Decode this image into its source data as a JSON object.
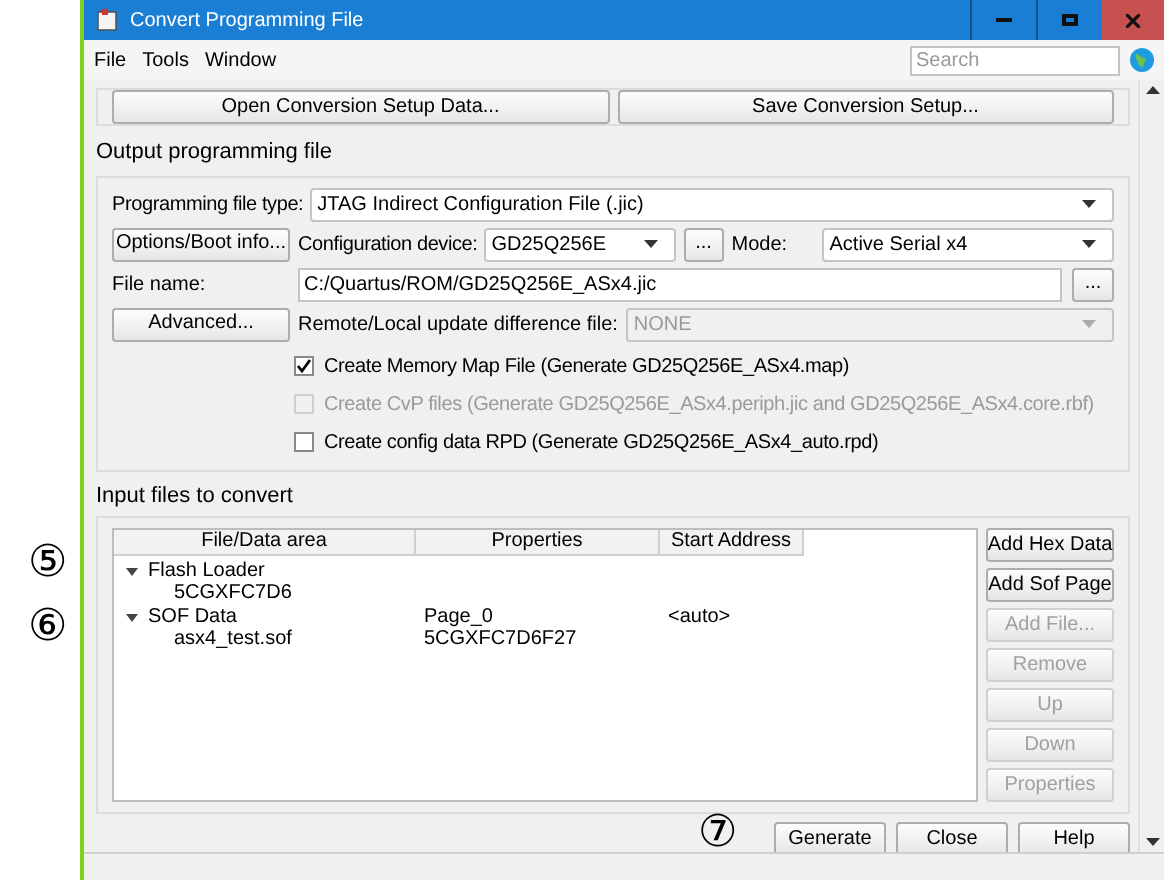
{
  "window": {
    "title": "Convert Programming File"
  },
  "menu": [
    {
      "label": "File"
    },
    {
      "label": "Tools"
    },
    {
      "label": "Window"
    }
  ],
  "search": {
    "placeholder": "Search"
  },
  "setup_buttons": [
    {
      "label": "Open Conversion Setup Data..."
    },
    {
      "label": "Save Conversion Setup..."
    }
  ],
  "output": {
    "title": "Output programming file",
    "file_type": {
      "label": "Programming file type:",
      "value": "JTAG Indirect Configuration File (.jic)"
    },
    "options_button": "Options/Boot info...",
    "config_device": {
      "label": "Configuration device:",
      "value": "GD25Q256E",
      "browse": "..."
    },
    "mode": {
      "label": "Mode:",
      "value": "Active Serial x4"
    },
    "file_name": {
      "label": "File name:",
      "value": "C:/Quartus/ROM/GD25Q256E_ASx4.jic",
      "browse": "..."
    },
    "advanced_button": "Advanced...",
    "remote_local": {
      "label": "Remote/Local update difference file:",
      "value": "NONE",
      "disabled": true
    },
    "checkboxes": [
      {
        "label": "Create Memory Map File (Generate GD25Q256E_ASx4.map)",
        "checked": true,
        "disabled": false
      },
      {
        "label": "Create CvP files (Generate GD25Q256E_ASx4.periph.jic and GD25Q256E_ASx4.core.rbf)",
        "checked": false,
        "disabled": true
      },
      {
        "label": "Create config data RPD (Generate GD25Q256E_ASx4_auto.rpd)",
        "checked": false,
        "disabled": false
      }
    ]
  },
  "input": {
    "title": "Input files to convert",
    "columns": [
      "File/Data area",
      "Properties",
      "Start Address"
    ],
    "rows": [
      {
        "cells": [
          "Flash Loader",
          "",
          ""
        ],
        "expanded": true,
        "children": [
          {
            "cells": [
              "5CGXFC7D6",
              "",
              ""
            ]
          }
        ]
      },
      {
        "cells": [
          "SOF Data",
          "Page_0",
          "<auto>"
        ],
        "expanded": true,
        "children": [
          {
            "cells": [
              "asx4_test.sof",
              "5CGXFC7D6F27",
              ""
            ]
          }
        ]
      }
    ],
    "buttons": [
      {
        "label": "Add Hex Data",
        "disabled": false
      },
      {
        "label": "Add Sof Page",
        "disabled": false
      },
      {
        "label": "Add File...",
        "disabled": true
      },
      {
        "label": "Remove",
        "disabled": true
      },
      {
        "label": "Up",
        "disabled": true
      },
      {
        "label": "Down",
        "disabled": true
      },
      {
        "label": "Properties",
        "disabled": true
      }
    ]
  },
  "footer_buttons": [
    {
      "label": "Generate"
    },
    {
      "label": "Close"
    },
    {
      "label": "Help"
    }
  ],
  "annotations": [
    "⑤",
    "⑥",
    "⑦"
  ]
}
